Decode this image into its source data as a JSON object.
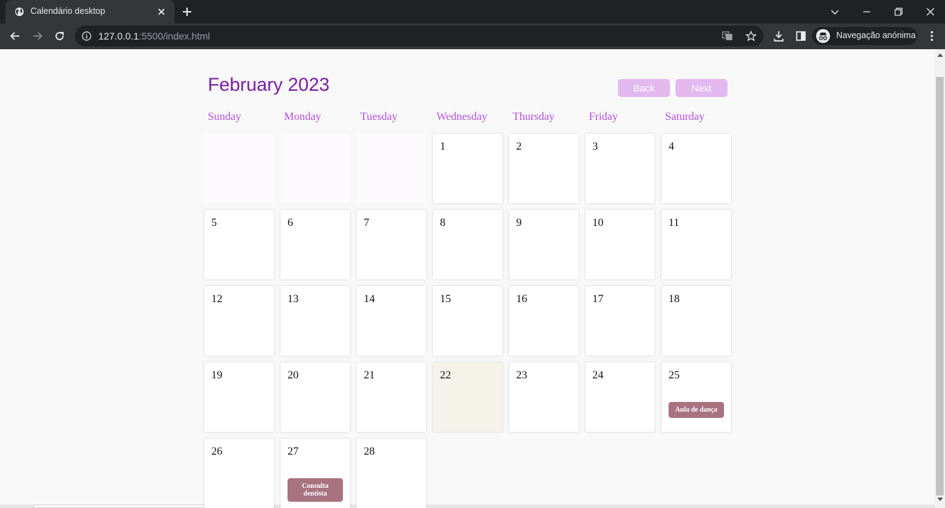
{
  "browser": {
    "tab_title": "Calendário desktop",
    "url_host": "127.0.0.1",
    "url_rest": ":5500/index.html",
    "profile_label": "Navegação anónima"
  },
  "calendar": {
    "month_title": "February 2023",
    "back_label": "Back",
    "next_label": "Next",
    "weekdays": [
      "Sunday",
      "Monday",
      "Tuesday",
      "Wednesday",
      "Thursday",
      "Friday",
      "Saturday"
    ],
    "leading_blank_days": 3,
    "days": [
      "1",
      "2",
      "3",
      "4",
      "5",
      "6",
      "7",
      "8",
      "9",
      "10",
      "11",
      "12",
      "13",
      "14",
      "15",
      "16",
      "17",
      "18",
      "19",
      "20",
      "21",
      "22",
      "23",
      "24",
      "25",
      "26",
      "27",
      "28"
    ],
    "today": "22",
    "events": [
      {
        "day": "25",
        "title": "Aula de dança"
      },
      {
        "day": "27",
        "title": "Consulta dentista"
      }
    ]
  },
  "colors": {
    "title": "#7a1ea1",
    "weekday": "#b44fd6",
    "nav_button": "#e3b8ef",
    "event": "#a8737f",
    "today": "#f5f2ea"
  }
}
